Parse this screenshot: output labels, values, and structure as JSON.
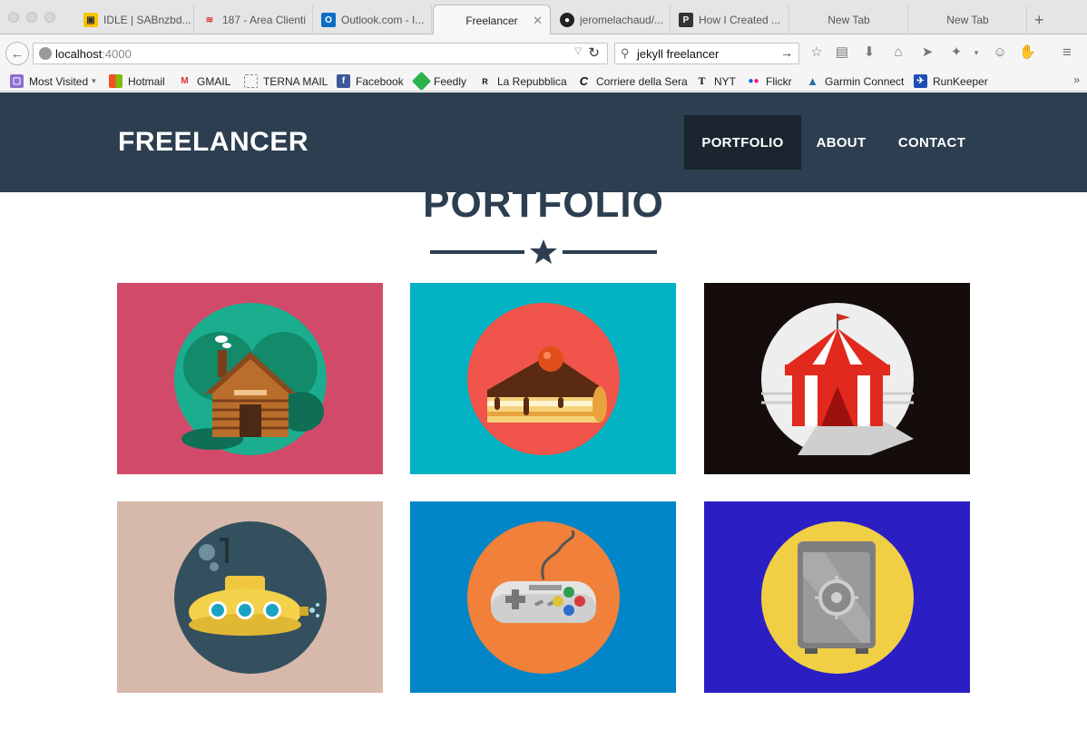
{
  "browser": {
    "tabs": [
      {
        "label": "IDLE | SABnzbd..."
      },
      {
        "label": "187 - Area Clienti"
      },
      {
        "label": "Outlook.com - I..."
      },
      {
        "label": "Freelancer",
        "active": true
      },
      {
        "label": "jeromelachaud/..."
      },
      {
        "label": "How I Created ..."
      },
      {
        "label": "New Tab"
      },
      {
        "label": "New Tab"
      }
    ],
    "url": {
      "host": "localhost",
      "port": ":4000"
    },
    "search_value": "jekyll freelancer",
    "bookmarks": [
      {
        "label": "Most Visited"
      },
      {
        "label": "Hotmail"
      },
      {
        "label": "GMAIL"
      },
      {
        "label": "TERNA MAIL"
      },
      {
        "label": "Facebook"
      },
      {
        "label": "Feedly"
      },
      {
        "label": "La Repubblica"
      },
      {
        "label": "Corriere della Sera"
      },
      {
        "label": "NYT"
      },
      {
        "label": "Flickr"
      },
      {
        "label": "Garmin Connect"
      },
      {
        "label": "RunKeeper"
      }
    ]
  },
  "site": {
    "brand": "FREELANCER",
    "nav": [
      {
        "label": "PORTFOLIO",
        "active": true
      },
      {
        "label": "ABOUT"
      },
      {
        "label": "CONTACT"
      }
    ],
    "section_title": "PORTFOLIO",
    "portfolio": [
      {
        "icon": "cabin-icon",
        "bg": "#d24a6a",
        "circle": "#1aae8f"
      },
      {
        "icon": "cake-icon",
        "bg": "#00b2c2",
        "circle": "#f0544a"
      },
      {
        "icon": "circus-tent-icon",
        "bg": "#150c0c",
        "circle": "#eeeeee"
      },
      {
        "icon": "submarine-icon",
        "bg": "#d6b9ab",
        "circle": "#34505f"
      },
      {
        "icon": "game-controller-icon",
        "bg": "#0085c8",
        "circle": "#f0803a"
      },
      {
        "icon": "safe-icon",
        "bg": "#2b1fc4",
        "circle": "#f1cf44"
      }
    ],
    "colors": {
      "primary": "#2c3e50",
      "nav_active": "#1a252f"
    }
  }
}
